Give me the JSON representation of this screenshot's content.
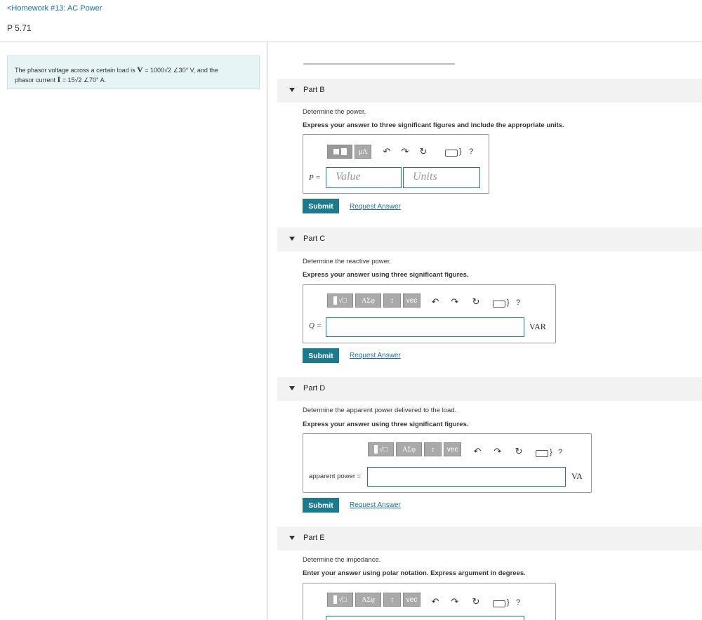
{
  "header": {
    "back_link": "<Homework #13: AC Power",
    "problem_number": "P 5.71"
  },
  "problem": {
    "text1": "The phasor voltage across a certain load is ",
    "V_sym": "V",
    "V_val": " = 1000√2 ∠30° V,",
    "text2": " and the",
    "text3": "phasor current ",
    "I_sym": "I",
    "I_val": " = 15√2 ∠70° A."
  },
  "toolbar": {
    "mu_label": "μA",
    "greek_label": "ΑΣφ",
    "arrows_label": "↕",
    "vec_label": "vec",
    "sqrt_label": "√□",
    "help_label": "?"
  },
  "parts": [
    {
      "title": "Part B",
      "prompt": "Determine the power.",
      "instruction": "Express your answer to three significant figures and include the appropriate units.",
      "var_label": "P =",
      "value_placeholder": "Value",
      "units_placeholder": "Units",
      "submit": "Submit",
      "request": "Request Answer"
    },
    {
      "title": "Part C",
      "prompt": "Determine the reactive power.",
      "instruction": "Express your answer using three significant figures.",
      "var_label": "Q =",
      "unit": "VAR",
      "submit": "Submit",
      "request": "Request Answer"
    },
    {
      "title": "Part D",
      "prompt": "Determine the apparent power delivered to the load.",
      "instruction": "Express your answer using three significant figures.",
      "var_label": "apparent power =",
      "unit": "VA",
      "submit": "Submit",
      "request": "Request Answer"
    },
    {
      "title": "Part E",
      "prompt": "Determine the impedance.",
      "instruction": "Enter your answer using polar notation. Express argument in degrees."
    }
  ],
  "colors": {
    "accent": "#1d7a8c",
    "link": "#1a6fa8",
    "problem_bg": "#e6f4f5",
    "part_header_bg": "#f2f2f2"
  }
}
